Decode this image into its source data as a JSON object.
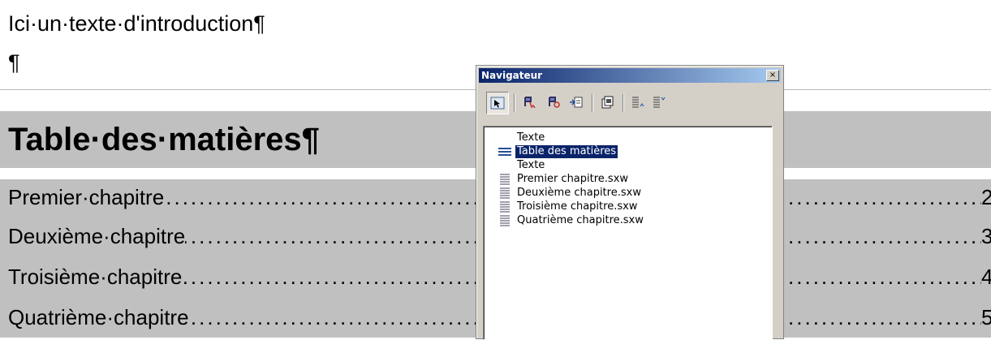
{
  "document": {
    "intro": "Ici·un·texte·d'introduction¶",
    "empty_para": "¶",
    "toc_title": "Table·des·matières¶",
    "toc_entries": [
      {
        "label": "Premier·chapitre",
        "page": "2¶"
      },
      {
        "label": "Deuxième·chapitre",
        "page": "3¶"
      },
      {
        "label": "Troisième·chapitre",
        "page": "4¶"
      },
      {
        "label": "Quatrième·chapitre",
        "page": "5¶"
      }
    ],
    "leader_dots": "............................................................................................................................................................................................................................................................................................................................................................"
  },
  "navigator": {
    "title": "Navigateur",
    "close": "×",
    "toolbar": [
      {
        "icon": "navigation-toggle-icon",
        "active": true
      },
      {
        "icon": "drag-mode-icon"
      },
      {
        "icon": "reminder-icon"
      },
      {
        "icon": "insert-icon"
      },
      {
        "icon": "document-list-icon"
      },
      {
        "icon": "promote-icon"
      },
      {
        "icon": "demote-icon"
      }
    ],
    "tree": [
      {
        "label": "Texte",
        "icon": "none"
      },
      {
        "label": "Table des matières",
        "icon": "index-icon",
        "selected": true
      },
      {
        "label": "Texte",
        "icon": "none"
      },
      {
        "label": "Premier chapitre.sxw",
        "icon": "section-icon"
      },
      {
        "label": "Deuxième chapitre.sxw",
        "icon": "section-icon"
      },
      {
        "label": "Troisième chapitre.sxw",
        "icon": "section-icon"
      },
      {
        "label": "Quatrième chapitre.sxw",
        "icon": "section-icon"
      }
    ]
  }
}
